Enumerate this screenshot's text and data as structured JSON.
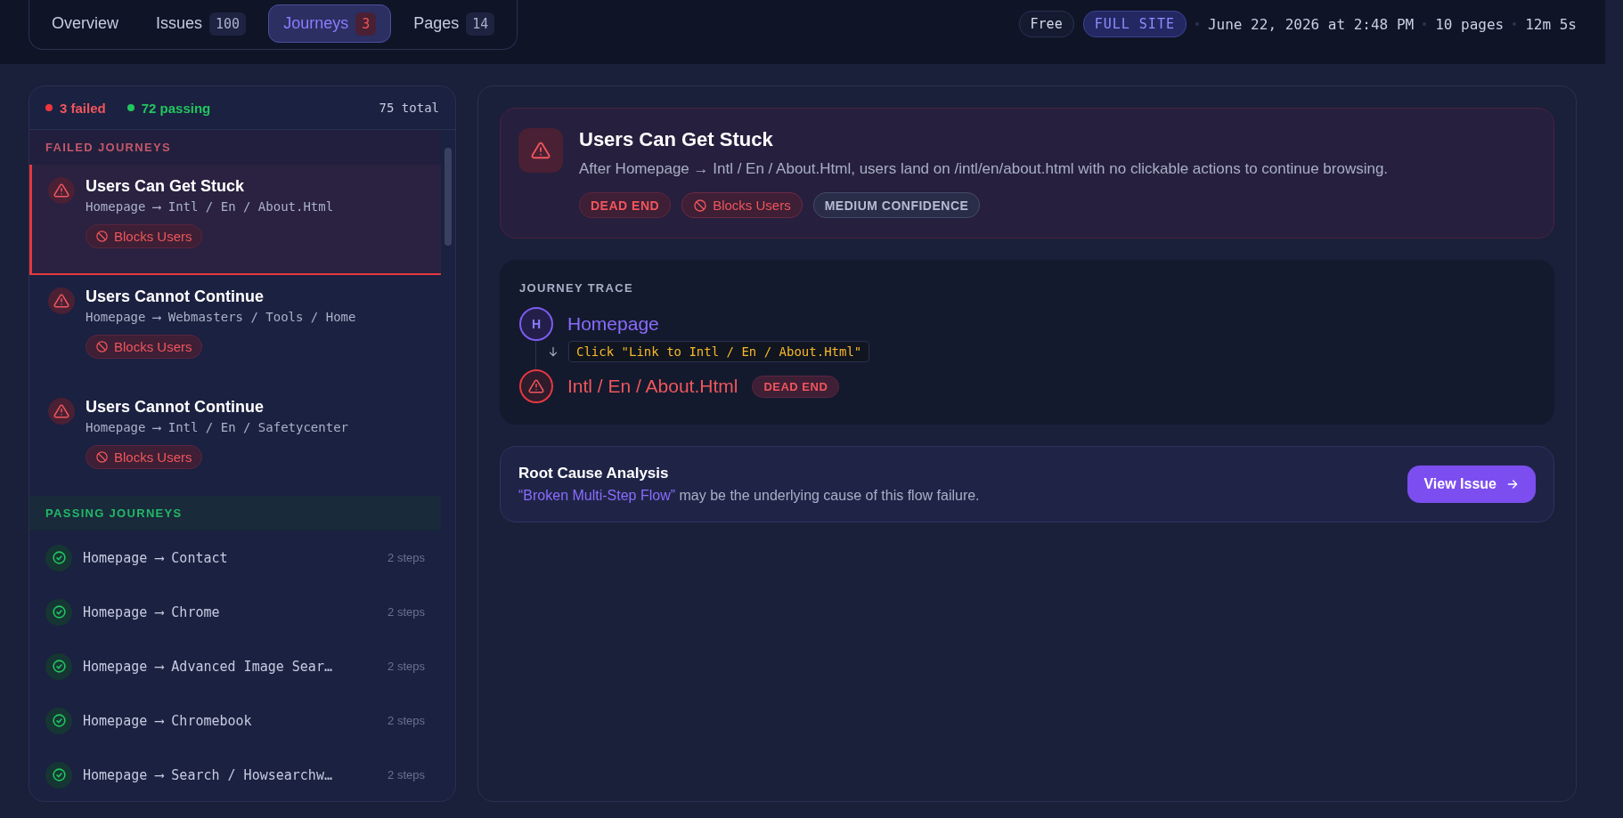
{
  "tabs": [
    {
      "label": "Overview",
      "selected": false
    },
    {
      "label": "Issues",
      "count": "100",
      "alert": false,
      "selected": false
    },
    {
      "label": "Journeys",
      "count": "3",
      "alert": true,
      "selected": true
    },
    {
      "label": "Pages",
      "count": "14",
      "alert": false,
      "selected": false
    }
  ],
  "header_meta": {
    "pills": [
      {
        "kind": "plan",
        "label": "Free"
      },
      {
        "kind": "scope",
        "label": "FULL SITE"
      }
    ],
    "items": [
      "June 22, 2026 at 2:48 PM",
      "10 pages",
      "12m 5s"
    ]
  },
  "journey_list": {
    "failed_count": "3 failed",
    "passing_count": "72 passing",
    "total": "75 total",
    "failed_heading": "FAILED JOURNEYS",
    "failed": [
      {
        "title": "Users Can Get Stuck",
        "route": "Homepage ⟶ Intl / En / About.Html",
        "tag": "Blocks Users",
        "selected": true
      },
      {
        "title": "Users Cannot Continue",
        "route": "Homepage ⟶ Webmasters / Tools / Home",
        "tag": "Blocks Users",
        "selected": false
      },
      {
        "title": "Users Cannot Continue",
        "route": "Homepage ⟶ Intl / En / Safetycenter",
        "tag": "Blocks Users",
        "selected": false
      }
    ],
    "passing_heading": "PASSING JOURNEYS",
    "passing": [
      {
        "route": "Homepage ⟶ Contact",
        "steps": "2 steps"
      },
      {
        "route": "Homepage ⟶ Chrome",
        "steps": "2 steps"
      },
      {
        "route": "Homepage ⟶ Advanced Image Sear…",
        "steps": "2 steps"
      },
      {
        "route": "Homepage ⟶ Chromebook",
        "steps": "2 steps"
      },
      {
        "route": "Homepage ⟶ Search / Howsearchw…",
        "steps": "2 steps"
      }
    ]
  },
  "detail": {
    "title": "Users Can Get Stuck",
    "description": "After Homepage → Intl / En / About.Html, users land on /intl/en/about.html with no clickable actions to continue browsing.",
    "tags": [
      {
        "kind": "dead_end",
        "label": "DEAD END"
      },
      {
        "kind": "blocks",
        "label": "Blocks Users"
      },
      {
        "kind": "confidence",
        "label": "MEDIUM CONFIDENCE"
      }
    ]
  },
  "trace": {
    "heading": "JOURNEY TRACE",
    "steps": [
      {
        "kind": "page",
        "initial": "H",
        "name": "Homepage",
        "action": "Click \"Link to Intl / En / About.Html\""
      },
      {
        "kind": "dead_end",
        "name": "Intl / En / About.Html",
        "badge": "DEAD END"
      }
    ]
  },
  "root_cause": {
    "title": "Root Cause Analysis",
    "link": "“Broken Multi-Step Flow”",
    "text": "may be the underlying cause of this flow failure.",
    "button": "View Issue"
  }
}
